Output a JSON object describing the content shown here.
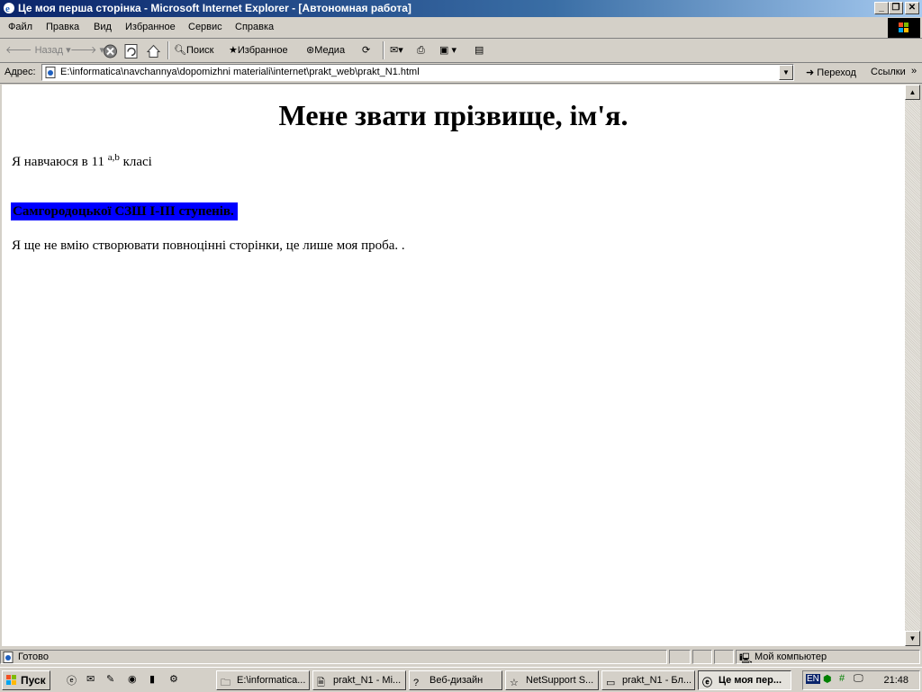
{
  "window": {
    "title": "Це моя перша сторінка - Microsoft Internet Explorer - [Автономная работа]"
  },
  "menu": [
    "Файл",
    "Правка",
    "Вид",
    "Избранное",
    "Сервис",
    "Справка"
  ],
  "toolbar": {
    "back": "Назад",
    "search": "Поиск",
    "favorites": "Избранное",
    "media": "Медиа"
  },
  "address": {
    "label": "Адрес:",
    "url": "E:\\informatica\\navchannya\\dopomizhni materiali\\internet\\prakt_web\\prakt_N1.html",
    "go": "Переход",
    "links": "Ссылки"
  },
  "page": {
    "heading": "Мене звати прізвище, ім'я.",
    "line1_pre": "Я навчаюся в 11 ",
    "line1_sup": "a,b",
    "line1_post": " класі",
    "school": "Самгородоцької СЗШ I-III ступенів.",
    "line3": "Я ще не вмію створювати повноцінні сторінки, це лише моя проба. ."
  },
  "status": {
    "text": "Готово",
    "zone": "Мой компьютер"
  },
  "taskbar": {
    "start": "Пуск",
    "tasks": [
      "E:\\informatica...",
      "prakt_N1 - Mi...",
      "Веб-дизайн",
      "NetSupport S...",
      "prakt_N1 - Бл...",
      "Це моя пер..."
    ],
    "lang": "EN",
    "clock": "21:48"
  },
  "colors": {
    "titlebar": "#0a246a",
    "highlight": "#0000ff"
  }
}
